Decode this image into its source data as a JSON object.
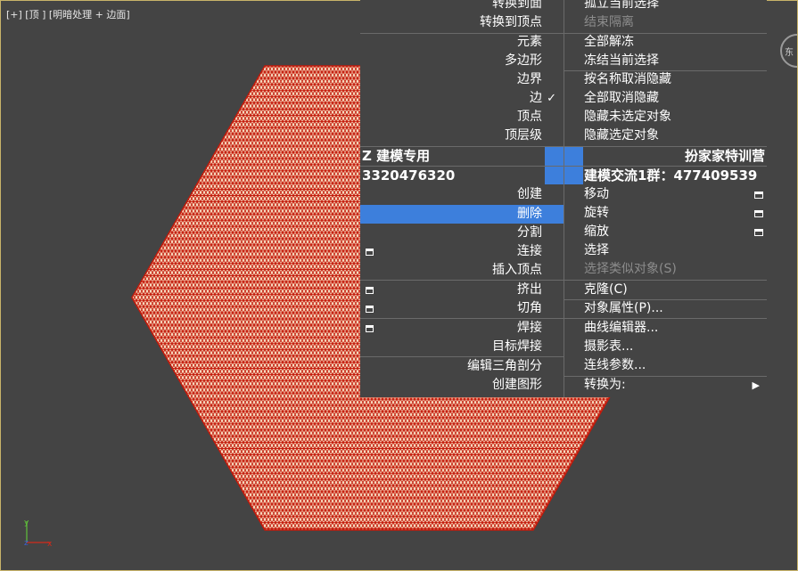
{
  "viewport": {
    "label": "[+] [顶 ] [明暗处理 + 边面]",
    "background": "#444444",
    "border_color": "#c8b36a",
    "mesh_fill": "#f7dcc0",
    "mesh_edge": "#c41a0b"
  },
  "quad_menu": {
    "left": {
      "items": [
        {
          "label": "转换到面"
        },
        {
          "label": "转换到顶点"
        },
        {
          "label": "元素"
        },
        {
          "label": "多边形"
        },
        {
          "label": "边界"
        },
        {
          "label": "边",
          "checked": true
        },
        {
          "label": "顶点"
        },
        {
          "label": "顶层级"
        },
        {
          "label": "创建"
        },
        {
          "label": "删除",
          "highlighted": true
        },
        {
          "label": "分割"
        },
        {
          "label": "连接",
          "settings_box": true
        },
        {
          "label": "插入顶点"
        },
        {
          "label": "挤出",
          "settings_box": true
        },
        {
          "label": "切角",
          "settings_box": true
        },
        {
          "label": "焊接",
          "settings_box": true
        },
        {
          "label": "目标焊接"
        },
        {
          "label": "编辑三角剖分"
        },
        {
          "label": "创建图形"
        }
      ],
      "title_top": "Z 建模专用",
      "title_bottom": "3320476320"
    },
    "right": {
      "items": [
        {
          "label": "孤立当前选择"
        },
        {
          "label": "结束隔离",
          "disabled": true
        },
        {
          "label": "全部解冻"
        },
        {
          "label": "冻结当前选择"
        },
        {
          "label": "按名称取消隐藏"
        },
        {
          "label": "全部取消隐藏"
        },
        {
          "label": "隐藏未选定对象"
        },
        {
          "label": "隐藏选定对象"
        },
        {
          "label": "移动",
          "settings_box": true
        },
        {
          "label": "旋转",
          "settings_box": true
        },
        {
          "label": "缩放",
          "settings_box": true
        },
        {
          "label": "选择"
        },
        {
          "label": "选择类似对象(S)",
          "disabled": true
        },
        {
          "label": "克隆(C)"
        },
        {
          "label": "对象属性(P)..."
        },
        {
          "label": "曲线编辑器..."
        },
        {
          "label": "摄影表..."
        },
        {
          "label": "连线参数..."
        },
        {
          "label": "转换为:",
          "submenu": true
        }
      ],
      "title_top": "扮家家特训营",
      "title_bottom": "建模交流1群：477409539"
    },
    "highlight_color": "#3d7fdc",
    "check_mark": "✓",
    "submenu_arrow": "▶"
  },
  "axis": {
    "x": "x",
    "y": "y",
    "z": "z"
  },
  "icons": {
    "viewcube": "viewcube-icon",
    "axis": "axis-tripod-icon"
  }
}
